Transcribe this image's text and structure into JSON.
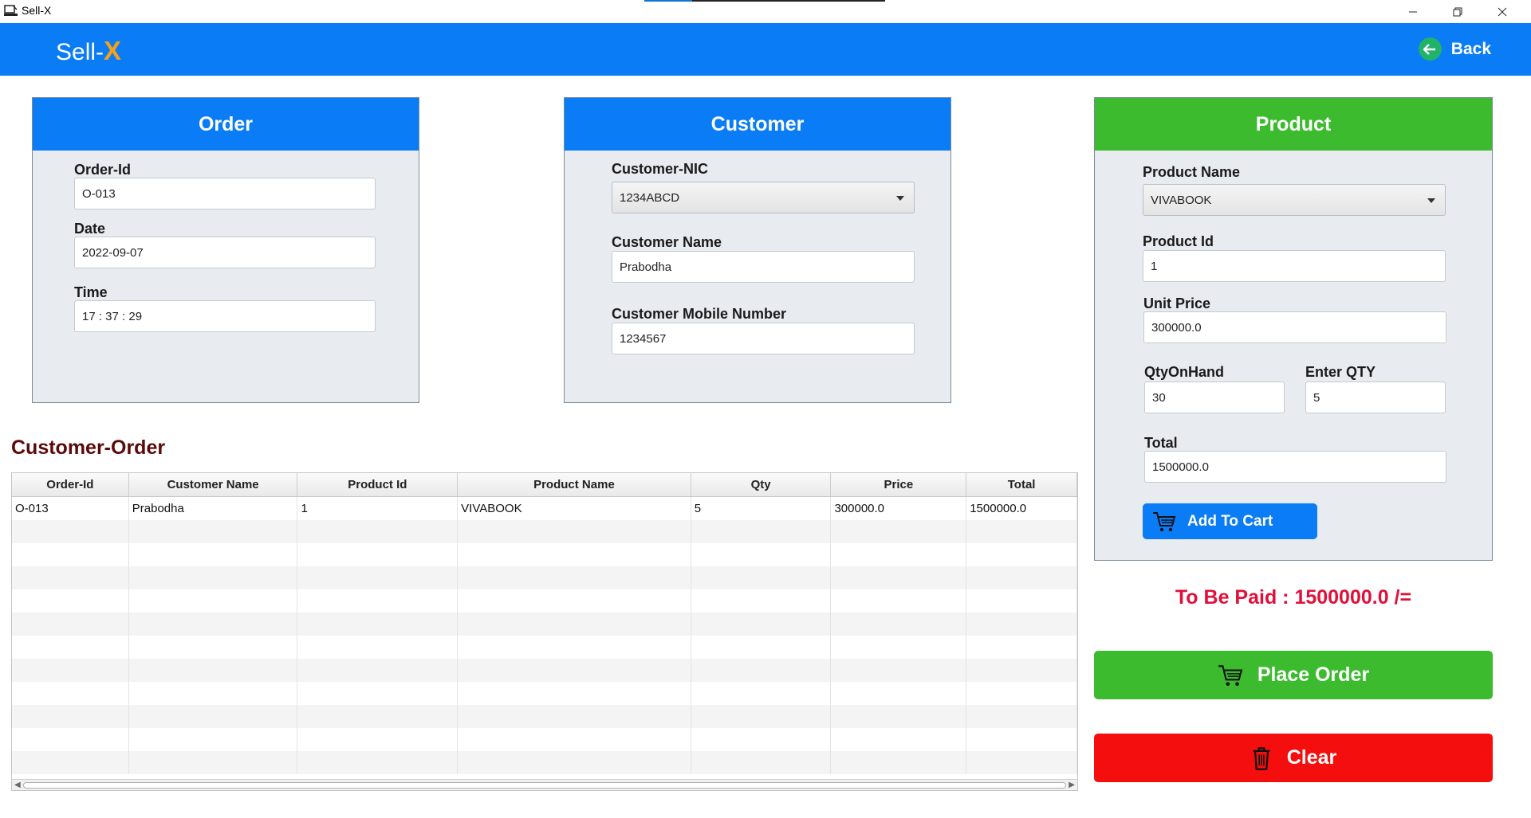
{
  "window": {
    "title": "Sell-X",
    "controls": [
      "minimize",
      "restore",
      "close"
    ]
  },
  "header": {
    "brand_prefix": "Sell-",
    "brand_x": "X",
    "back_label": "Back"
  },
  "order_panel": {
    "title": "Order",
    "order_id_label": "Order-Id",
    "order_id_value": "O-013",
    "date_label": "Date",
    "date_value": "2022-09-07",
    "time_label": "Time",
    "time_value": "17 : 37 : 29"
  },
  "customer_panel": {
    "title": "Customer",
    "nic_label": "Customer-NIC",
    "nic_value": "1234ABCD",
    "name_label": "Customer Name",
    "name_value": "Prabodha",
    "mobile_label": "Customer Mobile Number",
    "mobile_value": "1234567"
  },
  "product_panel": {
    "title": "Product",
    "name_label": "Product Name",
    "name_value": "VIVABOOK",
    "id_label": "Product Id",
    "id_value": "1",
    "price_label": "Unit Price",
    "price_value": "300000.0",
    "qoh_label": "QtyOnHand",
    "qoh_value": "30",
    "qty_label": "Enter QTY",
    "qty_value": "5",
    "total_label": "Total",
    "total_value": "1500000.0",
    "add_to_cart_label": "Add To Cart"
  },
  "table": {
    "title": "Customer-Order",
    "columns": [
      "Order-Id",
      "Customer Name",
      "Product Id",
      "Product Name",
      "Qty",
      "Price",
      "Total"
    ],
    "rows": [
      [
        "O-013",
        "Prabodha",
        "1",
        "VIVABOOK",
        "5",
        "300000.0",
        "1500000.0"
      ]
    ]
  },
  "summary": {
    "to_be_paid": "To Be Paid :  1500000.0 /="
  },
  "actions": {
    "place_order_label": "Place Order",
    "clear_label": "Clear"
  },
  "colors": {
    "primary_blue": "#0a7cf5",
    "green": "#3dbb2f",
    "red": "#f50e0e",
    "brand_accent": "#f7a11a",
    "heading_maroon": "#5a0a0a",
    "pay_text": "#e0103a"
  }
}
